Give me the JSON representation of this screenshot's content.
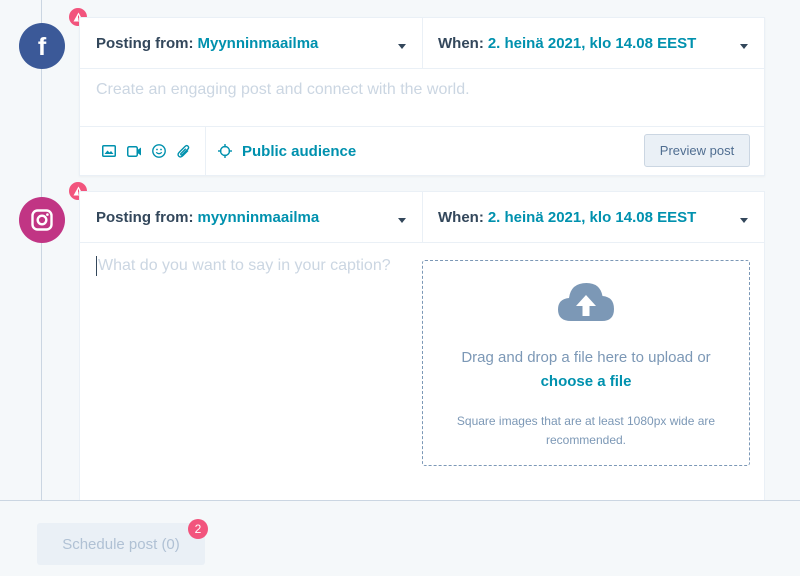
{
  "posts": [
    {
      "network": "facebook",
      "icon": "facebook-icon",
      "from_label": "Posting from:",
      "from_value": "Myynninmaailma",
      "when_label": "When:",
      "when_value": "2. heinä 2021, klo 14.08 EEST",
      "placeholder": "Create an engaging post and connect with the world.",
      "toolbar": {
        "icons": [
          "image-icon",
          "video-icon",
          "emoji-icon",
          "attachment-icon"
        ],
        "audience_label": "Public audience",
        "preview_label": "Preview post"
      }
    },
    {
      "network": "instagram",
      "icon": "instagram-icon",
      "from_label": "Posting from:",
      "from_value": "myynninmaailma",
      "when_label": "When:",
      "when_value": "2. heinä 2021, klo 14.08 EEST",
      "placeholder": "What do you want to say in your caption?",
      "upload": {
        "main_text": "Drag and drop a file here to upload or",
        "link_text": "choose a file",
        "note": "Square images that are at least 1080px wide are recommended."
      }
    }
  ],
  "footer": {
    "schedule_label": "Schedule post (0)",
    "badge_count": "2"
  },
  "colors": {
    "accent": "#0091ae",
    "facebook": "#3b5998",
    "instagram": "#c13584",
    "warning": "#f2547d"
  }
}
